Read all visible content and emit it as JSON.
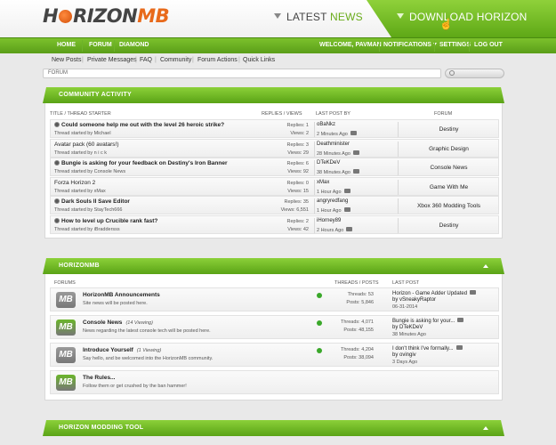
{
  "header": {
    "logo_left": "H",
    "logo_mid": "RIZON",
    "logo_mb": "MB",
    "latest_prefix": "LATEST",
    "latest_highlight": "NEWS",
    "download_label": "DOWNLOAD HORIZON",
    "colors": {
      "accent": "#6aac1b",
      "brand_orange": "#e86a1b",
      "nav_green": "#5a9e19"
    }
  },
  "nav": {
    "home": "HOME",
    "forum": "FORUM",
    "diamond": "DIAMOND",
    "welcome": "WELCOME, PAVMAN",
    "notifications": "NOTIFICATIONS",
    "settings": "SETTINGS",
    "logout": "LOG OUT"
  },
  "subnav": [
    "New Posts",
    "Private Messages",
    "FAQ",
    "Community",
    "Forum Actions",
    "Quick Links"
  ],
  "breadcrumb": "FORUM",
  "activity": {
    "title": "COMMUNITY ACTIVITY",
    "columns": {
      "thread": "TITLE / THREAD STARTER",
      "replies": "REPLIES / VIEWS",
      "lastpost": "LAST POST BY",
      "forum": "FORUM"
    },
    "rows": [
      {
        "title": "Could someone help me out with the level 26 heroic strike?",
        "starter": "Thread started by Michael",
        "replies": "Replies: 1",
        "views": "Views: 2",
        "lastby": "oBaNkz",
        "lastwhen": "2 Minutes Ago",
        "forum": "Destiny",
        "dot": true
      },
      {
        "title": "Avatar pack (60 avatars!)",
        "starter": "Thread started by n i c k",
        "replies": "Replies: 3",
        "views": "Views: 29",
        "lastby": "Deathminister",
        "lastwhen": "28 Minutes Ago",
        "forum": "Graphic Design",
        "dot": false
      },
      {
        "title": "Bungie is asking for your feedback on Destiny's Iron Banner",
        "starter": "Thread started by Console News",
        "replies": "Replies: 6",
        "views": "Views: 92",
        "lastby": "DTeKDeV",
        "lastwhen": "38 Minutes Ago",
        "forum": "Console News",
        "dot": true
      },
      {
        "title": "Forza Horizon 2",
        "starter": "Thread started by xMax",
        "replies": "Replies: 0",
        "views": "Views: 15",
        "lastby": "xMax",
        "lastwhen": "1 Hour Ago",
        "forum": "Game With Me",
        "dot": false
      },
      {
        "title": "Dark Souls II Save Editor",
        "starter": "Thread started by StayTech666",
        "replies": "Replies: 35",
        "views": "Views: 6,551",
        "lastby": "angryredfang",
        "lastwhen": "1 Hour Ago",
        "forum": "Xbox 360 Modding Tools",
        "dot": true
      },
      {
        "title": "How to level up Crucible rank fast?",
        "starter": "Thread started by iBraddersss",
        "replies": "Replies: 2",
        "views": "Views: 42",
        "lastby": "iHorney89",
        "lastwhen": "2 Hours Ago",
        "forum": "Destiny",
        "dot": true
      }
    ]
  },
  "horizonmb": {
    "title": "HORIZONMB",
    "columns": {
      "forums": "FORUMS",
      "threads": "THREADS / POSTS",
      "lastpost": "LAST POST"
    },
    "forums": [
      {
        "name": "HorizonMB Announcements",
        "viewing": "",
        "desc": "Site news will be posted here.",
        "threads": "Threads: 53",
        "posts": "Posts: 5,846",
        "last_title": "Horizon - Game Adder Updated",
        "last_by": "by vSneakyRaptor",
        "last_when": "06-31-2014",
        "icon_color": "#9a9a9a"
      },
      {
        "name": "Console News",
        "viewing": "(14 Viewing)",
        "desc": "News regarding the latest console tech will be posted here.",
        "threads": "Threads: 4,071",
        "posts": "Posts: 48,155",
        "last_title": "Bungie is asking for your...",
        "last_by": "by DTeKDeV",
        "last_when": "38 Minutes Ago",
        "icon_color": "#6ab52a"
      },
      {
        "name": "Introduce Yourself",
        "viewing": "(1 Viewing)",
        "desc": "Say hello, and be welcomed into the HorizonMB community.",
        "threads": "Threads: 4,204",
        "posts": "Posts: 38,094",
        "last_title": "I don't think I've formally...",
        "last_by": "by ovingiv",
        "last_when": "3 Days Ago",
        "icon_color": "#9a9a9a"
      },
      {
        "name": "The Rules...",
        "viewing": "",
        "desc": "Follow them or get crushed by the ban hammer!",
        "threads": "",
        "posts": "",
        "last_title": "",
        "last_by": "",
        "last_when": "",
        "icon_color": "#6ab52a"
      }
    ]
  },
  "modding": {
    "title": "HORIZON MODDING TOOL"
  }
}
